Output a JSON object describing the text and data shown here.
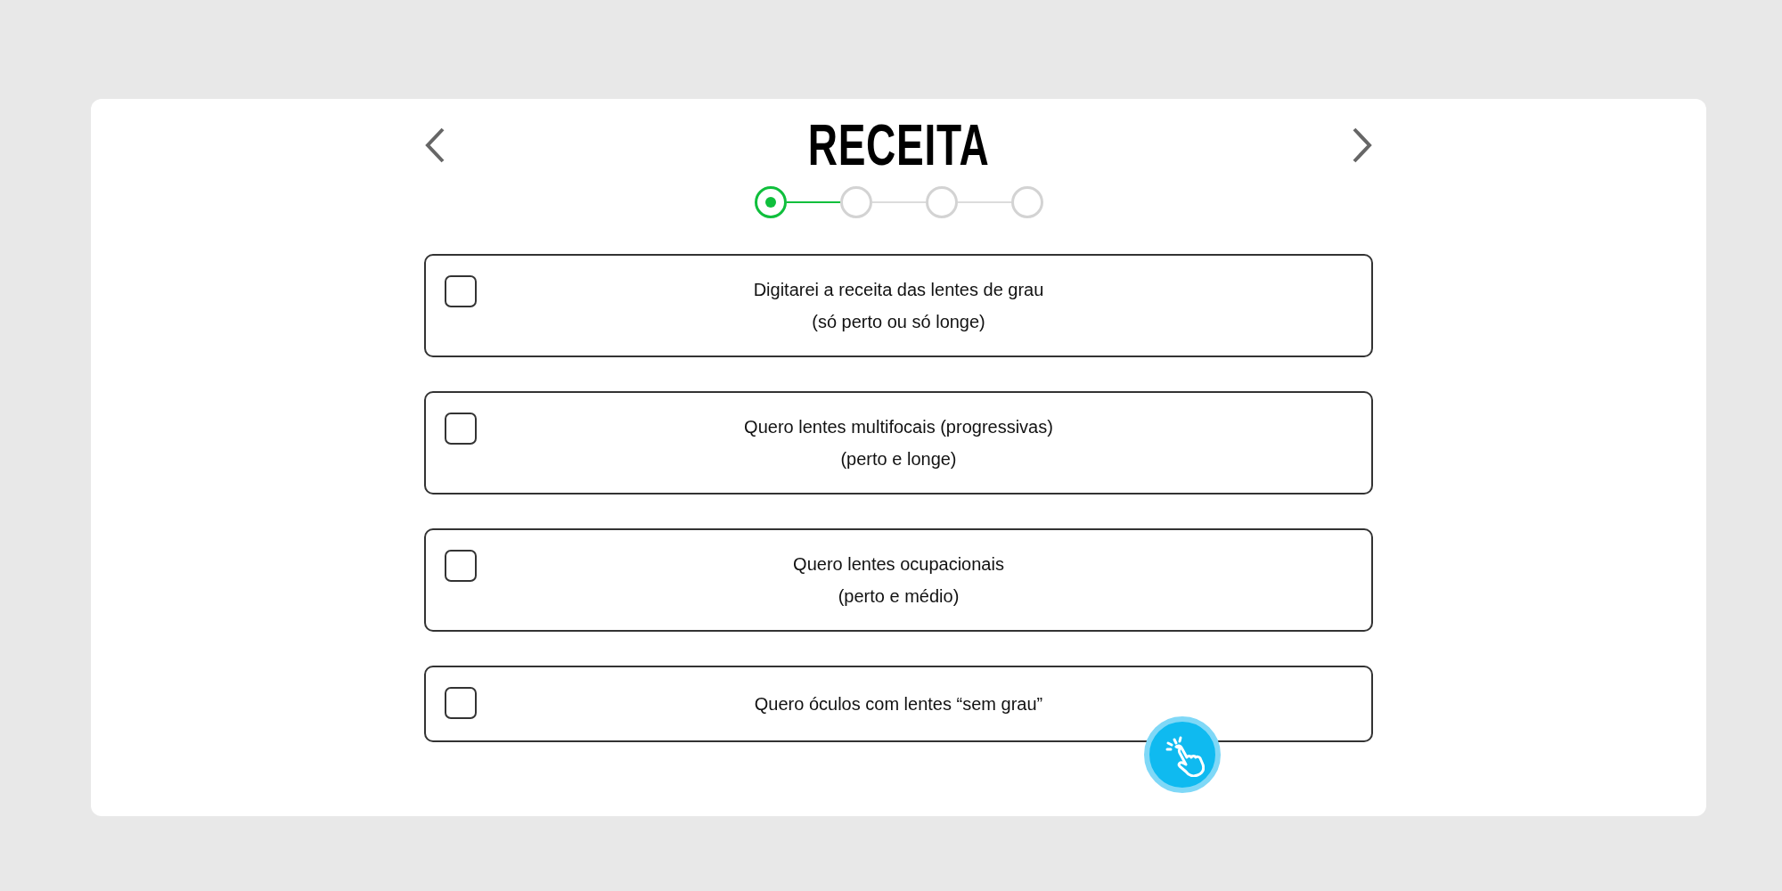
{
  "title": "RECEITA",
  "steps": [
    {
      "selected": true
    },
    {
      "selected": false
    },
    {
      "selected": false
    },
    {
      "selected": false
    }
  ],
  "options": [
    {
      "text": "Digitarei a receita das lentes de grau\n(só perto ou só longe)",
      "checked": false
    },
    {
      "text": "Quero lentes multifocais (progressivas)\n(perto e longe)",
      "checked": false
    },
    {
      "text": "Quero lentes ocupacionais\n(perto e médio)",
      "checked": false
    },
    {
      "text": "Quero óculos com lentes “sem grau”",
      "checked": false
    }
  ]
}
